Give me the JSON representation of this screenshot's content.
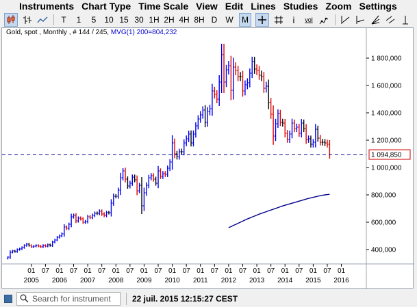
{
  "menu": {
    "items": [
      "Instruments",
      "Chart Type",
      "Time Scale",
      "View",
      "Edit",
      "Lines",
      "Studies",
      "Zoom",
      "Settings"
    ]
  },
  "toolbar": {
    "labels": [
      "T",
      "1",
      "5",
      "10",
      "15",
      "30",
      "1H",
      "2H",
      "4H",
      "8H",
      "D",
      "W",
      "M"
    ],
    "active_label": "M",
    "icon_info": "i",
    "icon_vol": "vol"
  },
  "header": {
    "instrument": "Gold, spot , Monthly , # 144 / 245,",
    "ma_label": "MVG(1) 200=804,232"
  },
  "status": {
    "search_placeholder": "Search for instrument",
    "timestamp": "22 juil. 2015 12:15:27 CEST"
  },
  "colors": {
    "up_bar": "#0000ee",
    "down_bar": "#dd0000",
    "neutral_bar": "#000000",
    "ma_line": "#00008b",
    "last_price_line": "#00008b",
    "last_price_box": "#cc0000"
  },
  "chart_data": {
    "type": "ohlc",
    "title": "Gold, spot , Monthly",
    "ylim": [
      300000,
      1950000
    ],
    "yticks": [
      400000,
      600000,
      800000,
      1000000,
      1200000,
      1400000,
      1600000,
      1800000
    ],
    "ytick_labels": [
      "400,000",
      "600,000",
      "800,000",
      "1 000,000",
      "1 200,000",
      "1 400,000",
      "1 600,000",
      "1 800,000"
    ],
    "month_ticks": [
      "01",
      "07",
      "01",
      "07",
      "01",
      "07",
      "01",
      "07",
      "01",
      "07",
      "01",
      "07",
      "01",
      "07",
      "01",
      "07",
      "01",
      "07",
      "01",
      "07",
      "01",
      "07",
      "01",
      "07"
    ],
    "year_labels": [
      "2005",
      "2006",
      "2007",
      "2008",
      "2009",
      "2010",
      "2011",
      "2012",
      "2013",
      "2014",
      "2015",
      "2016"
    ],
    "x_start": "2004-03",
    "last_price": 1094850,
    "last_price_label": "1 094,850",
    "closes": [
      345000,
      380000,
      390000,
      385000,
      400000,
      405000,
      415000,
      430000,
      440000,
      430000,
      420000,
      425000,
      430000,
      425000,
      420000,
      430000,
      425000,
      435000,
      430000,
      455000,
      470000,
      490000,
      500000,
      515000,
      565000,
      555000,
      585000,
      640000,
      650000,
      610000,
      630000,
      625000,
      600000,
      605000,
      640000,
      635000,
      650000,
      665000,
      665000,
      680000,
      660000,
      650000,
      670000,
      670000,
      740000,
      790000,
      790000,
      835000,
      925000,
      975000,
      915000,
      865000,
      885000,
      930000,
      910000,
      830000,
      870000,
      720000,
      815000,
      870000,
      925000,
      940000,
      915000,
      885000,
      975000,
      935000,
      955000,
      950000,
      995000,
      1040000,
      1180000,
      1100000,
      1080000,
      1115000,
      1115000,
      1180000,
      1210000,
      1245000,
      1180000,
      1245000,
      1305000,
      1355000,
      1385000,
      1420000,
      1330000,
      1410000,
      1430000,
      1560000,
      1535000,
      1500000,
      1625000,
      1825000,
      1625000,
      1715000,
      1745000,
      1565000,
      1735000,
      1710000,
      1665000,
      1665000,
      1560000,
      1605000,
      1620000,
      1690000,
      1775000,
      1720000,
      1710000,
      1675000,
      1665000,
      1580000,
      1595000,
      1475000,
      1390000,
      1230000,
      1320000,
      1395000,
      1330000,
      1325000,
      1250000,
      1205000,
      1245000,
      1325000,
      1285000,
      1295000,
      1250000,
      1325000,
      1285000,
      1205000,
      1210000,
      1170000,
      1185000,
      1280000,
      1215000,
      1185000,
      1185000,
      1180000,
      1170000,
      1094850
    ],
    "ma_closes": [
      560000,
      568000,
      576000,
      584000,
      592000,
      600000,
      608000,
      616000,
      624000,
      631000,
      638000,
      645000,
      652000,
      659000,
      665000,
      671000,
      677000,
      683000,
      689000,
      695000,
      701000,
      707000,
      713000,
      719000,
      724000,
      729000,
      734000,
      739000,
      744000,
      749000,
      754000,
      759000,
      764000,
      769000,
      774000,
      778000,
      782000,
      786000,
      790000,
      794000,
      797000,
      800000,
      802000,
      804232
    ]
  }
}
